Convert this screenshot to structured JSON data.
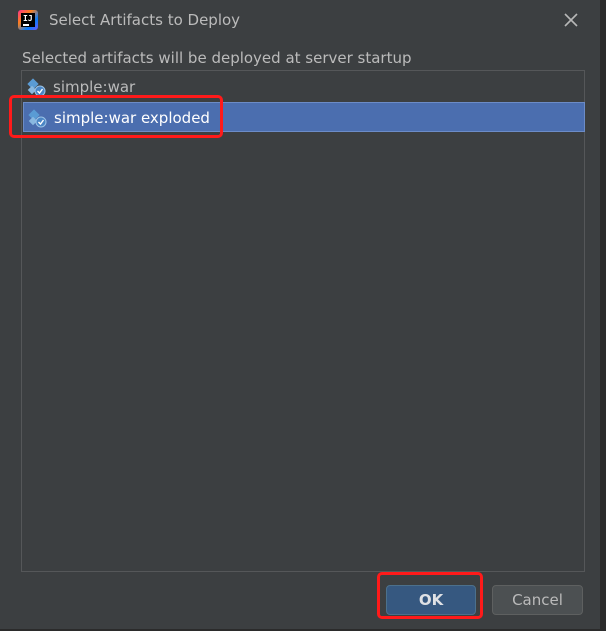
{
  "dialog": {
    "title": "Select Artifacts to Deploy",
    "description": "Selected artifacts will be deployed at server startup",
    "app_icon": "intellij-idea-icon",
    "close_icon": "close-icon"
  },
  "artifacts": [
    {
      "label": "simple:war",
      "icon": "artifact-icon",
      "selected": false
    },
    {
      "label": "simple:war exploded",
      "icon": "artifact-icon",
      "selected": true
    }
  ],
  "buttons": {
    "ok_label": "OK",
    "cancel_label": "Cancel"
  },
  "colors": {
    "dialog_bg": "#3c3f41",
    "selection": "#4b6eaf",
    "primary_button": "#365880",
    "annotation": "#ff1a1a"
  }
}
